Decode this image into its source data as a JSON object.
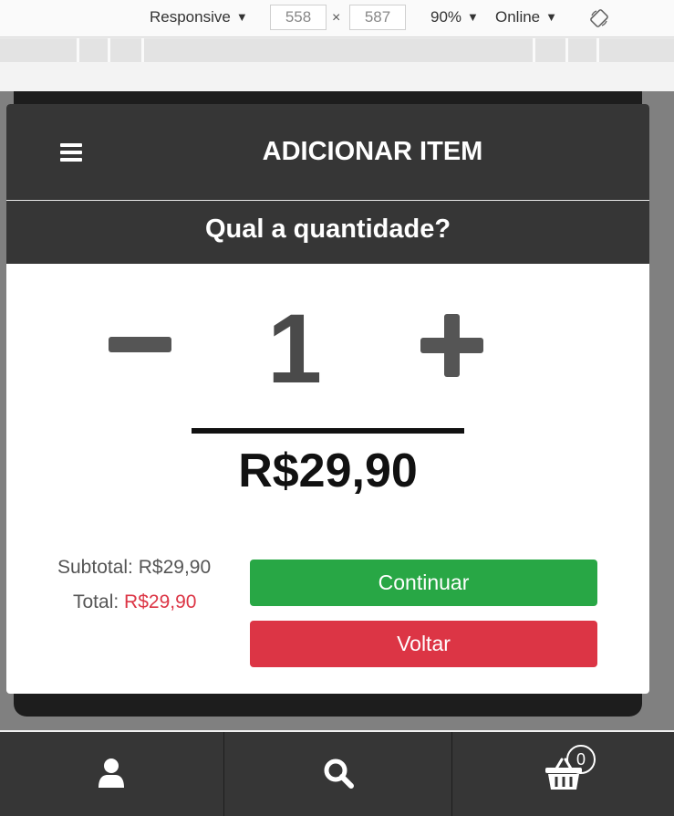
{
  "devtools": {
    "device_label": "Responsive",
    "width_value": "558",
    "height_value": "587",
    "times_symbol": "×",
    "zoom_label": "90%",
    "network_label": "Online",
    "caret": "▼"
  },
  "modal": {
    "title": "ADICIONAR ITEM",
    "question": "Qual a quantidade?",
    "quantity": "1",
    "price": "R$29,90",
    "subtotal_label": "Subtotal:",
    "subtotal_value": "R$29,90",
    "total_label": "Total:",
    "total_value": "R$29,90",
    "continue_label": "Continuar",
    "back_label": "Voltar"
  },
  "bottom_nav": {
    "items": [
      {
        "icon": "user-icon"
      },
      {
        "icon": "search-icon"
      },
      {
        "icon": "basket-icon"
      }
    ],
    "cart_count": "0"
  },
  "colors": {
    "header_bg": "#363636",
    "continue_green": "#28a745",
    "back_red": "#dc3545"
  }
}
